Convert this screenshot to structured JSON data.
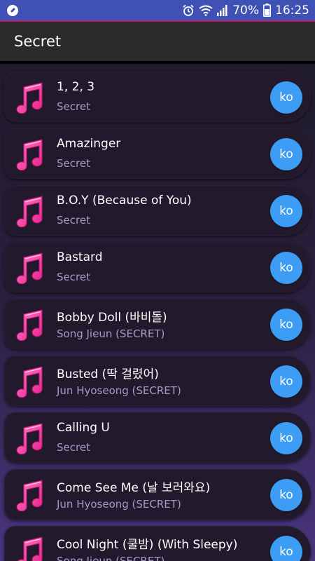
{
  "status_bar": {
    "battery_percent": "70%",
    "time": "16:25",
    "icons": [
      "app-notification-icon",
      "alarm-icon",
      "wifi-icon",
      "signal-icon",
      "battery-icon"
    ]
  },
  "app_bar": {
    "title": "Secret"
  },
  "accent_colors": {
    "note_icon": "#ff4fa8",
    "language_button": "#3d9cf3",
    "status_bar": "#3f51b5"
  },
  "songs": [
    {
      "title": "1, 2, 3",
      "artist": "Secret",
      "lang": "ko"
    },
    {
      "title": "Amazinger",
      "artist": "Secret",
      "lang": "ko"
    },
    {
      "title": "B.O.Y (Because of You)",
      "artist": "Secret",
      "lang": "ko"
    },
    {
      "title": "Bastard",
      "artist": "Secret",
      "lang": "ko"
    },
    {
      "title": "Bobby Doll (바비돌)",
      "artist": "Song Jieun (SECRET)",
      "lang": "ko"
    },
    {
      "title": "Busted (딱 걸렸어)",
      "artist": "Jun Hyoseong (SECRET)",
      "lang": "ko"
    },
    {
      "title": "Calling U",
      "artist": "Secret",
      "lang": "ko"
    },
    {
      "title": "Come See Me (날 보러와요)",
      "artist": "Jun Hyoseong (SECRET)",
      "lang": "ko"
    },
    {
      "title": "Cool Night (쿨밤) (With Sleepy)",
      "artist": "Song Jieun (SECRET)",
      "lang": "ko"
    }
  ]
}
